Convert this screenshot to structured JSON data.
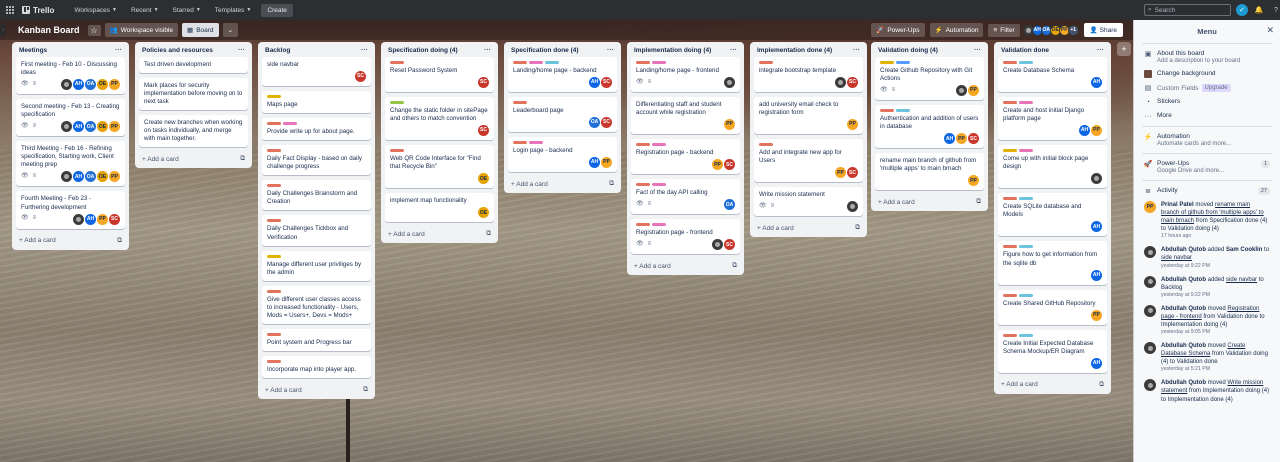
{
  "nav": {
    "brand": "Trello",
    "menus": [
      "Workspaces",
      "Recent",
      "Starred",
      "Templates"
    ],
    "create": "Create",
    "search_placeholder": "Search"
  },
  "board": {
    "title": "Kanban Board",
    "visibility": "Workspace visible",
    "view": "Board",
    "powerups": "Power-Ups",
    "automation": "Automation",
    "filter": "Filter",
    "share": "Share",
    "member_more": "+1"
  },
  "lists": [
    {
      "title": "Meetings",
      "cards": [
        {
          "text": "First meeting - Feb 10 - Discussing ideas",
          "labels": [],
          "badges": true,
          "members": [
            "ph",
            "AH",
            "OA",
            "OE",
            "PP"
          ]
        },
        {
          "text": "Second meeting - Feb 13 - Creating specification",
          "labels": [],
          "badges": true,
          "members": [
            "ph",
            "AH",
            "OA",
            "OE",
            "PP"
          ]
        },
        {
          "text": "Third Meeting - Feb 16 - Refining specification, Starting work, Client meeting prep",
          "labels": [],
          "badges": true,
          "members": [
            "ph",
            "AH",
            "OA",
            "OE",
            "PP"
          ]
        },
        {
          "text": "Fourth Meeting - Feb 23 - Furthering development",
          "labels": [],
          "badges": true,
          "members": [
            "ph",
            "AH",
            "PP",
            "SC"
          ]
        }
      ],
      "add": "Add a card"
    },
    {
      "title": "Policies and resources",
      "cards": [
        {
          "text": "Test driven development",
          "labels": [],
          "badges": false,
          "members": []
        },
        {
          "text": "Mark places for security implementation before moving on to next task",
          "labels": [],
          "badges": false,
          "members": []
        },
        {
          "text": "Create new branches when working on tasks individually, and merge with main together.",
          "labels": [],
          "badges": false,
          "members": []
        }
      ],
      "add": "Add a card"
    },
    {
      "title": "Backlog",
      "cards": [
        {
          "text": "side navbar",
          "labels": [],
          "badges": false,
          "members": [
            "SC"
          ]
        },
        {
          "text": "Maps page",
          "labels": [
            "yellow"
          ],
          "badges": false,
          "members": []
        },
        {
          "text": "Provide write up for about page.",
          "labels": [
            "red",
            "pink"
          ],
          "badges": false,
          "members": []
        },
        {
          "text": "Daily Fact Display - based on daily challenge progress",
          "labels": [
            "red"
          ],
          "badges": false,
          "members": []
        },
        {
          "text": "Daily Challenges Brainstorm and Creation",
          "labels": [
            "red"
          ],
          "badges": false,
          "members": []
        },
        {
          "text": "Daily Challenges Tickbox and Verification",
          "labels": [
            "red"
          ],
          "badges": false,
          "members": []
        },
        {
          "text": "Manage different user priviliges by the admin",
          "labels": [
            "yellow"
          ],
          "badges": false,
          "members": []
        },
        {
          "text": "Give different user classes access to increased functionality - Users, Mods = Users+, Devs = Mods+",
          "labels": [
            "red"
          ],
          "badges": false,
          "members": []
        },
        {
          "text": "Point system and Progress bar",
          "labels": [
            "red"
          ],
          "badges": false,
          "members": []
        },
        {
          "text": "Incorporate map into player app.",
          "labels": [
            "red"
          ],
          "badges": false,
          "members": []
        }
      ],
      "add": "Add a card"
    },
    {
      "title": "Specification doing (4)",
      "cards": [
        {
          "text": "Reset Password System",
          "labels": [
            "red"
          ],
          "badges": false,
          "members": [
            "SC"
          ]
        },
        {
          "text": "Change the static folder in sitePage and others to match convention",
          "labels": [
            "green"
          ],
          "badges": false,
          "members": [
            "SC"
          ]
        },
        {
          "text": "Web QR Code Interface for \"Find that Recycle Bin\"",
          "labels": [
            "red"
          ],
          "badges": false,
          "members": [
            "OE"
          ]
        },
        {
          "text": "implement map functionality",
          "labels": [],
          "badges": false,
          "members": [
            "OE"
          ]
        }
      ],
      "add": "Add a card"
    },
    {
      "title": "Specification done (4)",
      "cards": [
        {
          "text": "Landing/home page - backend",
          "labels": [
            "red",
            "pink",
            "teal"
          ],
          "badges": false,
          "members": [
            "AH",
            "SC"
          ]
        },
        {
          "text": "Leaderboard page",
          "labels": [
            "red"
          ],
          "badges": false,
          "members": [
            "OA",
            "SC"
          ]
        },
        {
          "text": "Login page - backend",
          "labels": [
            "red",
            "pink"
          ],
          "badges": false,
          "members": [
            "AH",
            "PP"
          ]
        }
      ],
      "add": "Add a card"
    },
    {
      "title": "Implementation doing (4)",
      "cards": [
        {
          "text": "Landing/home page - frontend",
          "labels": [
            "red",
            "pink"
          ],
          "badges": true,
          "members": [
            "ph"
          ]
        },
        {
          "text": "Differentiating staff and student account while registration",
          "labels": [],
          "badges": false,
          "members": [
            "PP"
          ]
        },
        {
          "text": "Registration page - backend",
          "labels": [
            "red",
            "pink"
          ],
          "badges": false,
          "members": [
            "PP",
            "SC"
          ]
        },
        {
          "text": "Fact of the day API calling",
          "labels": [
            "red",
            "pink"
          ],
          "badges": true,
          "members": [
            "OA"
          ]
        },
        {
          "text": "Registration page - frontend",
          "labels": [
            "red",
            "pink"
          ],
          "badges": true,
          "members": [
            "ph",
            "SC"
          ]
        }
      ],
      "add": "Add a card"
    },
    {
      "title": "Implementation done (4)",
      "cards": [
        {
          "text": "integrate bootstrap template",
          "labels": [
            "red"
          ],
          "badges": false,
          "members": [
            "ph",
            "SC"
          ]
        },
        {
          "text": "add university email check to registration form",
          "labels": [],
          "badges": false,
          "members": [
            "PP"
          ]
        },
        {
          "text": "Add and integrate new app for Users",
          "labels": [
            "red"
          ],
          "badges": false,
          "members": [
            "PP",
            "SC"
          ]
        },
        {
          "text": "Write mission statement",
          "labels": [],
          "badges": true,
          "members": [
            "ph"
          ]
        }
      ],
      "add": "Add a card"
    },
    {
      "title": "Validation doing (4)",
      "cards": [
        {
          "text": "Create Github Repository with Git Actions",
          "labels": [
            "yellow",
            "blue"
          ],
          "badges": true,
          "members": [
            "ph",
            "PP"
          ]
        },
        {
          "text": "Authentication and addition of users in database",
          "labels": [
            "red",
            "teal"
          ],
          "badges": false,
          "members": [
            "AH",
            "PP",
            "SC"
          ]
        },
        {
          "text": "rename main branch of github from 'multiple apps' to main brnach",
          "labels": [],
          "badges": false,
          "members": [
            "PP"
          ]
        }
      ],
      "add": "Add a card"
    },
    {
      "title": "Validation done",
      "cards": [
        {
          "text": "Create Database Schema",
          "labels": [
            "red",
            "teal"
          ],
          "badges": false,
          "members": [
            "AH"
          ]
        },
        {
          "text": "Create and host initial Django platform page",
          "labels": [
            "red",
            "pink"
          ],
          "badges": false,
          "members": [
            "AH",
            "PP"
          ]
        },
        {
          "text": "Come up with initial block page design",
          "labels": [
            "yellow",
            "pink"
          ],
          "badges": false,
          "members": [
            "ph"
          ]
        },
        {
          "text": "Create SQLite database and Models",
          "labels": [
            "red",
            "teal"
          ],
          "badges": false,
          "members": [
            "AH"
          ]
        },
        {
          "text": "Figure how to get information from the sqlite db",
          "labels": [
            "red",
            "teal"
          ],
          "badges": false,
          "members": [
            "AH"
          ]
        },
        {
          "text": "Create Shared GitHub Repository",
          "labels": [
            "red",
            "teal"
          ],
          "badges": false,
          "members": [
            "PP"
          ]
        },
        {
          "text": "Create Initial Expected Database Schema Mockup/ER Diagram",
          "labels": [
            "red",
            "teal"
          ],
          "badges": false,
          "members": [
            "AH"
          ]
        }
      ],
      "add": "Add a card"
    }
  ],
  "menu": {
    "title": "Menu",
    "about_title": "About this board",
    "about_desc": "Add a description to your board",
    "change_bg": "Change background",
    "custom_fields": "Custom Fields",
    "upgrade": "Upgrade",
    "stickers": "Stickers",
    "more": "More",
    "automation_title": "Automation",
    "automation_desc": "Automate cards and more...",
    "powerups_title": "Power-Ups",
    "powerups_desc": "Google Drive and more...",
    "powerups_count": "1",
    "activity_title": "Activity",
    "activity_count": "27",
    "activity": [
      {
        "who": "Prinal Patel",
        "av": "PP",
        "pre": "moved",
        "link": "rename main branch of github from 'multiple apps' to main brnach",
        "post": "from Specification done (4) to Validation doing (4)",
        "time": "17 hours ago"
      },
      {
        "who": "Abdullah Qutob",
        "av": "ph",
        "pre": "added",
        "bold2": "Sam Cooklin",
        "mid": "to",
        "link": "side navbar",
        "post": "",
        "time": "yesterday at 9:22 PM"
      },
      {
        "who": "Abdullah Qutob",
        "av": "ph",
        "pre": "added",
        "link": "side navbar",
        "post": "to Backlog",
        "time": "yesterday at 9:22 PM"
      },
      {
        "who": "Abdullah Qutob",
        "av": "ph",
        "pre": "moved",
        "link": "Registration page - frontend",
        "post": "from Validation done to Implementation doing (4)",
        "time": "yesterday at 9:05 PM"
      },
      {
        "who": "Abdullah Qutob",
        "av": "ph",
        "pre": "moved",
        "link": "Create Database Schema",
        "post": "from Validation doing (4) to Validation done",
        "time": "yesterday at 5:21 PM"
      },
      {
        "who": "Abdullah Qutob",
        "av": "ph",
        "pre": "moved",
        "link": "Write mission statement",
        "post": "from Implementation doing (4) to Implementation done (4)",
        "time": ""
      }
    ]
  }
}
